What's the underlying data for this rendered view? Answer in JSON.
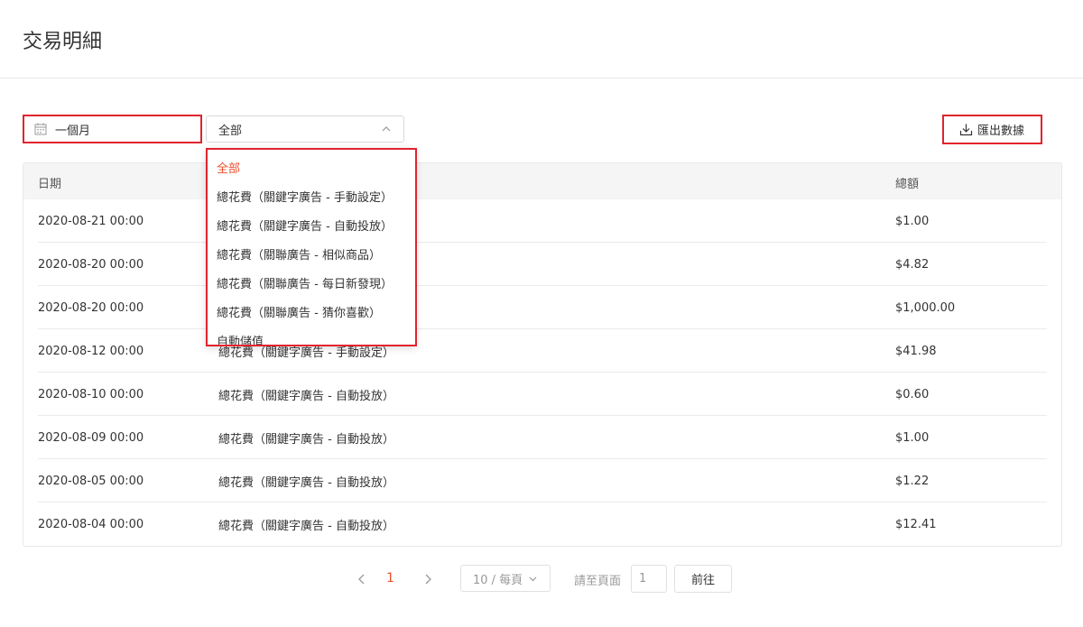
{
  "page": {
    "title": "交易明細"
  },
  "filters": {
    "date_range": "一個月",
    "type_selected": "全部",
    "type_options": [
      "全部",
      "總花費（關鍵字廣告 - 手動設定）",
      "總花費（關鍵字廣告 - 自動投放）",
      "總花費（關聯廣告 - 相似商品）",
      "總花費（關聯廣告 - 每日新發現）",
      "總花費（關聯廣告 - 猜你喜歡）",
      "自動儲值"
    ]
  },
  "toolbar": {
    "export_label": "匯出數據"
  },
  "table": {
    "headers": {
      "date": "日期",
      "amount": "總額"
    },
    "rows": [
      {
        "date": "2020-08-21 00:00",
        "desc": "",
        "amount": "$1.00"
      },
      {
        "date": "2020-08-20 00:00",
        "desc": "",
        "amount": "$4.82"
      },
      {
        "date": "2020-08-20 00:00",
        "desc": "",
        "amount": "$1,000.00"
      },
      {
        "date": "2020-08-12 00:00",
        "desc": "總花費（關鍵字廣告 - 手動設定）",
        "amount": "$41.98"
      },
      {
        "date": "2020-08-10 00:00",
        "desc": "總花費（關鍵字廣告 - 自動投放）",
        "amount": "$0.60"
      },
      {
        "date": "2020-08-09 00:00",
        "desc": "總花費（關鍵字廣告 - 自動投放）",
        "amount": "$1.00"
      },
      {
        "date": "2020-08-05 00:00",
        "desc": "總花費（關鍵字廣告 - 自動投放）",
        "amount": "$1.22"
      },
      {
        "date": "2020-08-04 00:00",
        "desc": "總花費（關鍵字廣告 - 自動投放）",
        "amount": "$12.41"
      }
    ]
  },
  "pagination": {
    "current_page": "1",
    "page_size": "10 / 每頁",
    "goto_label": "請至頁面",
    "goto_value": "1",
    "go_label": "前往"
  },
  "colors": {
    "accent": "#ee4d2d",
    "highlight": "#e0242e"
  },
  "icons": [
    "calendar-icon",
    "chevron-up-icon",
    "download-icon",
    "chevron-left-icon",
    "chevron-right-icon",
    "chevron-down-icon"
  ]
}
